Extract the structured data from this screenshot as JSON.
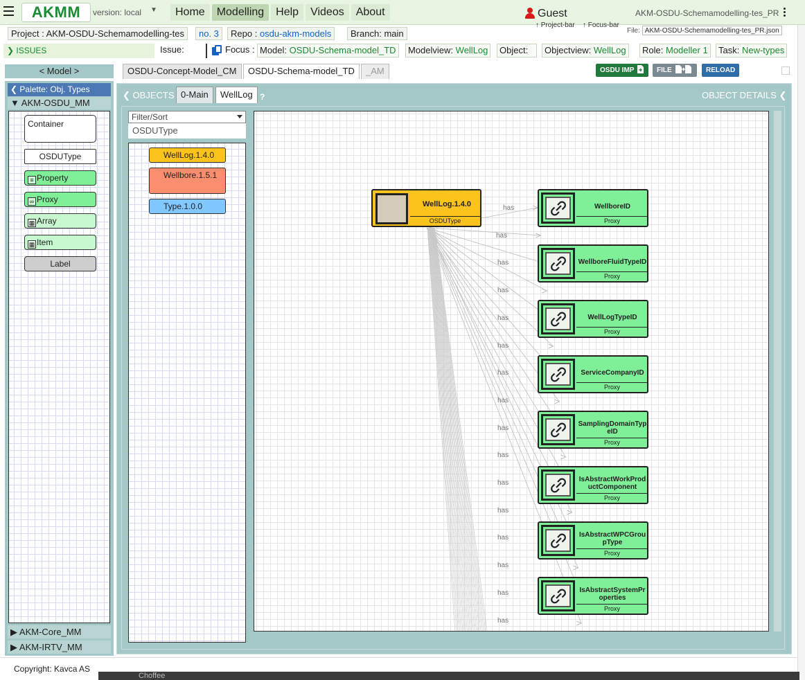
{
  "nav": {
    "brand": "AKMM",
    "version": "version: local",
    "links": [
      "Home",
      "Modelling",
      "Help",
      "Videos",
      "About"
    ],
    "active_link": "Modelling",
    "user": "Guest",
    "file_title": "AKM-OSDU-Schemamodelling-tes_PR"
  },
  "project_bar": {
    "project_label": "Project :",
    "project_name": "AKM-OSDU-Schemamodelling-tes",
    "project_no": "no. 3",
    "repo_label": "Repo :",
    "repo_name": "osdu-akm-models",
    "branch_label": "Branch:",
    "branch_name": "main",
    "hint_project": "↑ Project-bar",
    "hint_focus": "↑ Focus-bar",
    "file_label": "File:",
    "file_name": "AKM-OSDU-Schemamodelling-tes_PR.json"
  },
  "focus_bar": {
    "issues": "ISSUES",
    "issue_label": "Issue:",
    "focus_label": "Focus :",
    "model_label": "Model:",
    "model_value": "OSDU-Schema-model_TD",
    "modelview_label": "Modelview:",
    "modelview_value": "WellLog",
    "object_label": "Object:",
    "object_value": "",
    "objectview_label": "Objectview:",
    "objectview_value": "WellLog",
    "role_label": "Role:",
    "role_value": "Modeller 1",
    "task_label": "Task:",
    "task_value": "New-types"
  },
  "tabs": {
    "model_button": "< Model >",
    "model_tabs": [
      "OSDU-Concept-Model_CM",
      "OSDU-Schema-model_TD",
      "_AM"
    ],
    "active_tab": "OSDU-Schema-model_TD",
    "buttons": {
      "osdu_import": "OSDU IMP",
      "file": "FILE",
      "reload": "RELOAD"
    },
    "button_colors": {
      "osdu_import": "#1f7a3c",
      "file": "#7b8a92",
      "reload": "#2f6ea8"
    }
  },
  "palette": {
    "title": "Palette: Obj. Types",
    "metamodel": "AKM-OSDU_MM",
    "items": [
      {
        "label": "Container",
        "icon": ""
      },
      {
        "label": "OSDUType",
        "icon": ""
      },
      {
        "label": "Property",
        "icon": "property-icon"
      },
      {
        "label": "Proxy",
        "icon": "link-icon"
      },
      {
        "label": "Array",
        "icon": "grid-icon"
      },
      {
        "label": "Item",
        "icon": "grid-icon"
      },
      {
        "label": "Label",
        "icon": ""
      }
    ],
    "other_metamodels": [
      "AKM-Core_MM",
      "AKM-IRTV_MM"
    ]
  },
  "main": {
    "objects_label": "OBJECTS",
    "view_tabs": [
      "0-Main",
      "WellLog"
    ],
    "active_view": "WellLog",
    "help_mark": "?",
    "details_label": "OBJECT DETAILS",
    "filter_placeholder": "Filter/Sort",
    "object_type": "OSDUType",
    "object_nodes": [
      {
        "label": "WellLog.1.4.0",
        "color": "#fcc31d"
      },
      {
        "label": "Wellbore.1.5.1",
        "color": "#fa8e6f"
      },
      {
        "label": "Type.1.0.0",
        "color": "#80c8ff"
      }
    ]
  },
  "diagram": {
    "main_node": {
      "name": "WellLog.1.4.0",
      "type": "OSDUType",
      "color": "#fcc31d"
    },
    "relation_label": "has",
    "relation_labels_count": 16,
    "proxy_nodes": [
      {
        "name": "WellboreID",
        "type": "Proxy"
      },
      {
        "name": "WellboreFluidTypeID",
        "type": "Proxy"
      },
      {
        "name": "WellLogTypeID",
        "type": "Proxy"
      },
      {
        "name": "ServiceCompanyID",
        "type": "Proxy"
      },
      {
        "name": "SamplingDomainTypeID",
        "type": "Proxy"
      },
      {
        "name": "IsAbstractWorkProductComponent",
        "type": "Proxy"
      },
      {
        "name": "IsAbstractWPCGroupType",
        "type": "Proxy"
      },
      {
        "name": "IsAbstractSystemProperties",
        "type": "Proxy"
      }
    ],
    "proxy_color": "#7fef98"
  },
  "footer": {
    "copyright": "Copyright: Kavca AS",
    "background_text": "Choffee"
  }
}
